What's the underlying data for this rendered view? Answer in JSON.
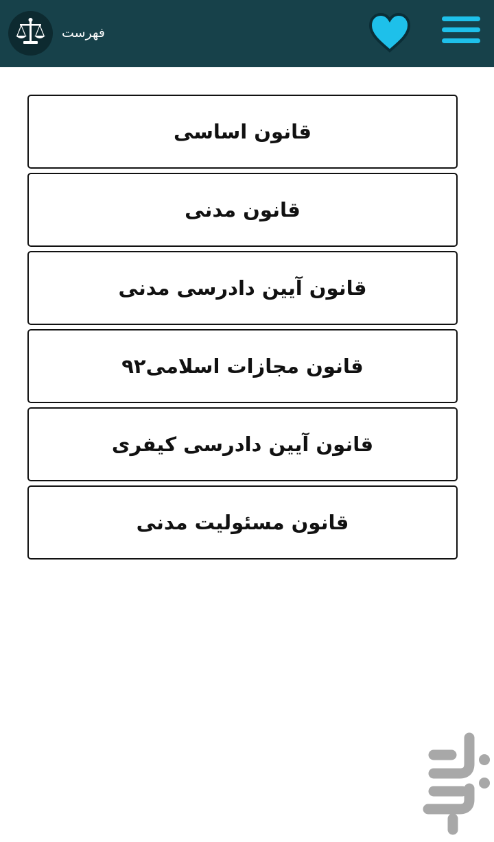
{
  "header": {
    "title": "فهرست",
    "logo_icon": "scales-of-justice-icon",
    "favorite_icon": "heart-icon",
    "menu_icon": "hamburger-menu-icon",
    "background_color": "#17414a",
    "accent_color": "#1ec0ea"
  },
  "laws": [
    {
      "label": "قانون اساسی"
    },
    {
      "label": "قانون مدنی"
    },
    {
      "label": "قانون آیین دادرسی مدنی"
    },
    {
      "label": "قانون مجازات اسلامی۹۲"
    },
    {
      "label": "قانون آیین دادرسی کیفری"
    },
    {
      "label": "قانون مسئولیت مدنی"
    }
  ],
  "watermark_icon": "bazaar-logo-icon"
}
